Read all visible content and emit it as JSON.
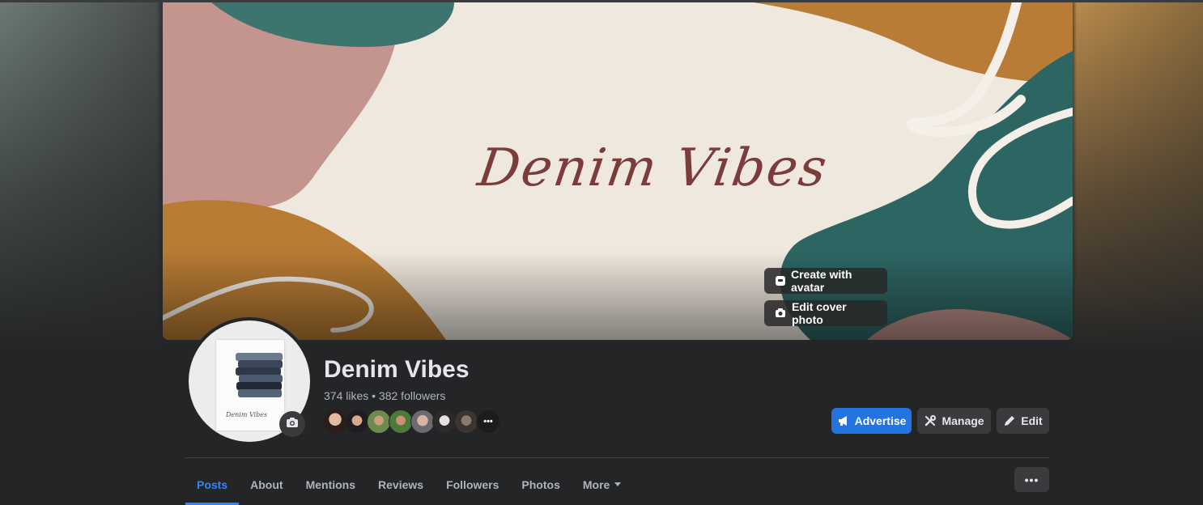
{
  "cover": {
    "title": "Denim Vibes",
    "create_avatar_label": "Create with avatar",
    "edit_cover_label": "Edit cover photo"
  },
  "profile": {
    "avatar_signature": "Denim Vibes",
    "name": "Denim Vibes",
    "stats": "374 likes • 382 followers",
    "more_faces": "•••"
  },
  "actions": {
    "advertise": "Advertise",
    "manage": "Manage",
    "edit": "Edit"
  },
  "tabs": [
    {
      "label": "Posts",
      "active": true
    },
    {
      "label": "About"
    },
    {
      "label": "Mentions"
    },
    {
      "label": "Reviews"
    },
    {
      "label": "Followers"
    },
    {
      "label": "Photos"
    },
    {
      "label": "More"
    }
  ],
  "tabs_more_button": "•••",
  "colors": {
    "accent": "#2374e1",
    "active_tab": "#2d88ff",
    "background": "#242526",
    "button_gray": "#3a3b3c"
  }
}
